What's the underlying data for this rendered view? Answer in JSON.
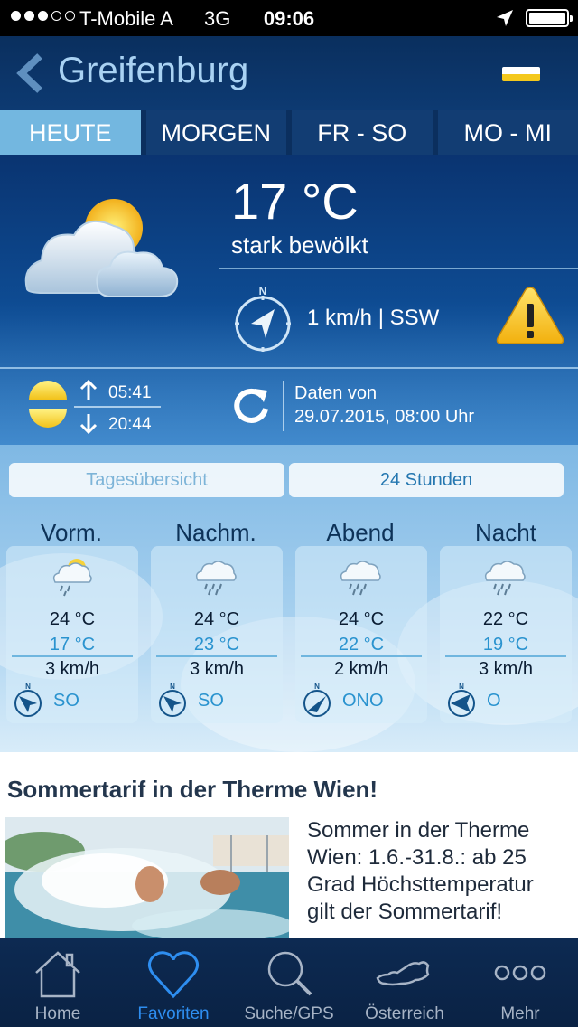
{
  "status_bar": {
    "carrier": "T-Mobile A",
    "network": "3G",
    "time": "09:06",
    "signal_bars": 3,
    "signal_total": 5
  },
  "header": {
    "location_name": "Greifenburg",
    "flag_colors": [
      "#ffffff",
      "#f4c81d"
    ]
  },
  "tabs": [
    {
      "label": "HEUTE",
      "active": true
    },
    {
      "label": "MORGEN",
      "active": false
    },
    {
      "label": "FR - SO",
      "active": false
    },
    {
      "label": "MO - MI",
      "active": false
    }
  ],
  "current": {
    "icon": "partly-cloudy-icon",
    "temperature": "17 °C",
    "condition": "stark bewölkt",
    "wind": "1 km/h | SSW",
    "warning_icon": "warning-icon",
    "sunrise": "05:41",
    "sunset": "20:44",
    "data_label": "Daten von",
    "data_timestamp": "29.07.2015, 08:00 Uhr"
  },
  "view_toggle": {
    "overview_label": "Tagesübersicht",
    "hours_label": "24 Stunden"
  },
  "periods": [
    {
      "label": "Vorm.",
      "icon": "sun-cloud-rain-icon",
      "high": "24 °C",
      "low": "17 °C",
      "wind": "3 km/h",
      "direction": "SO"
    },
    {
      "label": "Nachm.",
      "icon": "cloud-rain-icon",
      "high": "24 °C",
      "low": "23 °C",
      "wind": "3 km/h",
      "direction": "SO"
    },
    {
      "label": "Abend",
      "icon": "cloud-rain-icon",
      "high": "24 °C",
      "low": "22 °C",
      "wind": "2 km/h",
      "direction": "ONO"
    },
    {
      "label": "Nacht",
      "icon": "cloud-rain-icon",
      "high": "22 °C",
      "low": "19 °C",
      "wind": "3 km/h",
      "direction": "O"
    }
  ],
  "news": {
    "title": "Sommertarif in der Therme Wien!",
    "text_lines": [
      "Sommer in der Therme",
      "Wien: 1.6.-31.8.: ab 25",
      "Grad Höchsttemperatur",
      "gilt der Sommertarif!"
    ]
  },
  "tab_bar": [
    {
      "label": "Home",
      "icon": "home-icon",
      "active": false
    },
    {
      "label": "Favoriten",
      "icon": "heart-icon",
      "active": true
    },
    {
      "label": "Suche/GPS",
      "icon": "search-icon",
      "active": false
    },
    {
      "label": "Österreich",
      "icon": "austria-map-icon",
      "active": false
    },
    {
      "label": "Mehr",
      "icon": "more-icon",
      "active": false
    }
  ],
  "colors": {
    "header_bg": "#0d3a72",
    "active_tab": "#73b7e0",
    "accent_blue": "#2e8ef0",
    "low_temp_blue": "#2a93cf",
    "warning_yellow": "#f7c318"
  }
}
